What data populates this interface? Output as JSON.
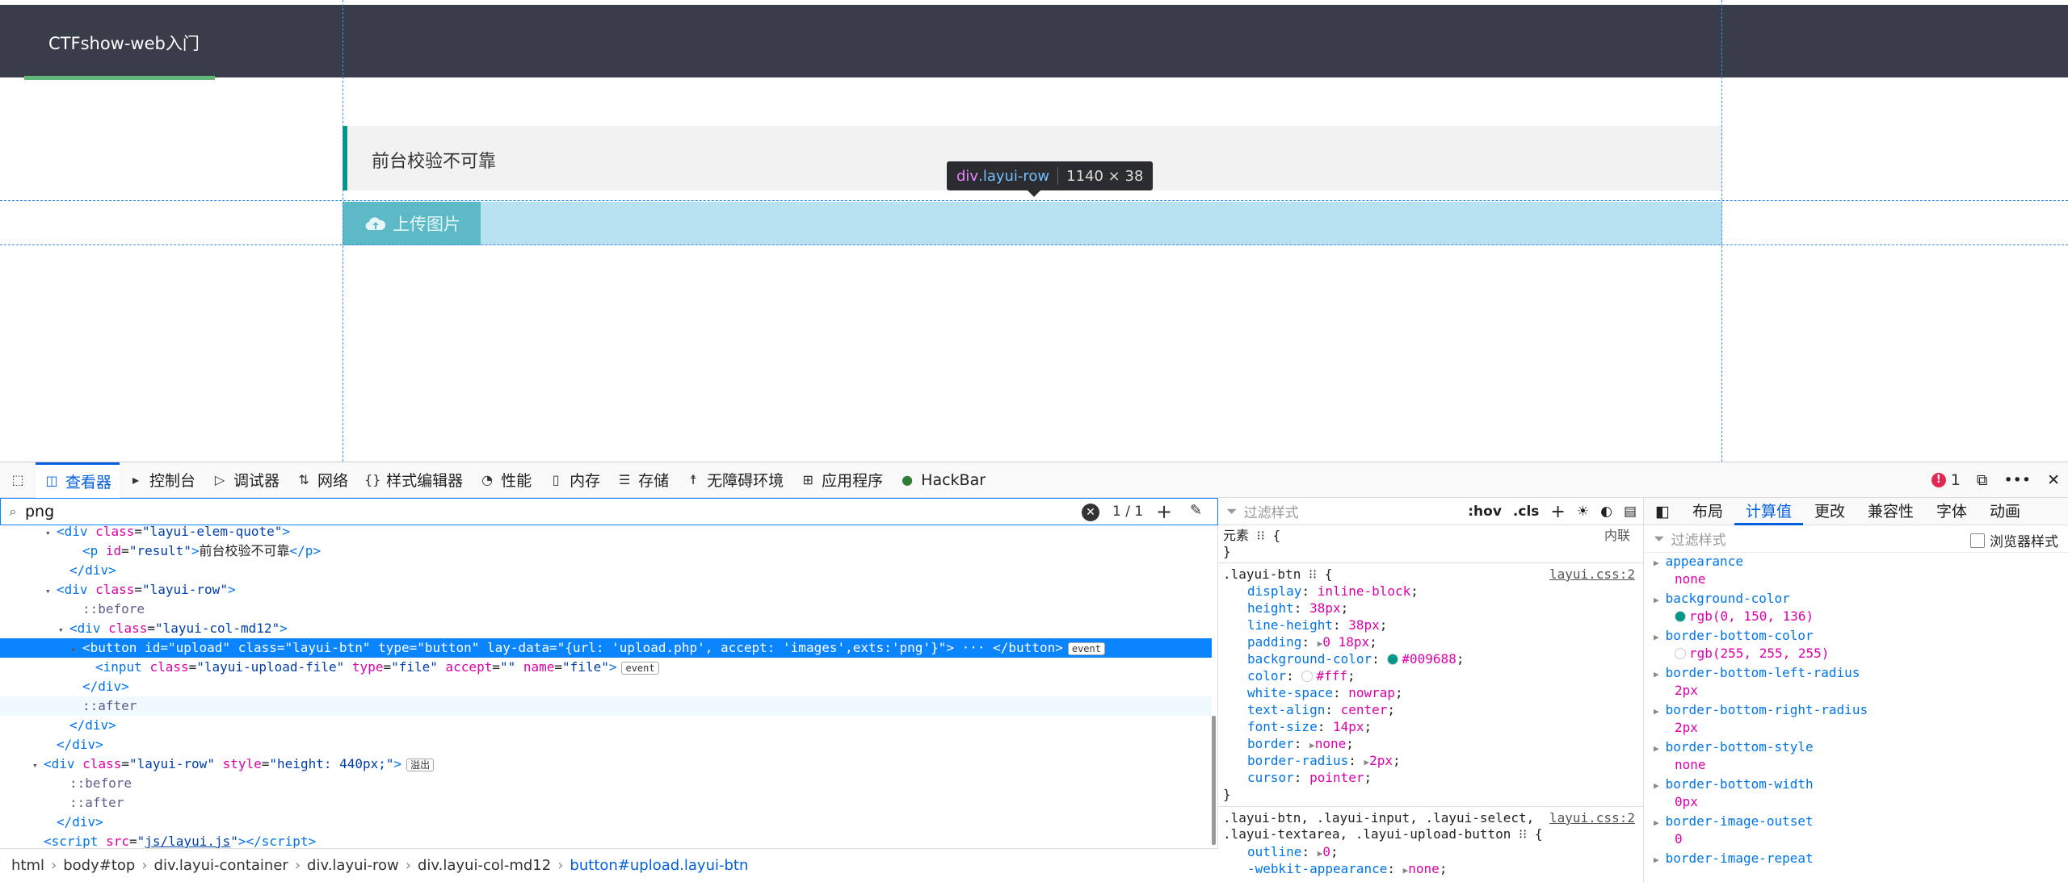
{
  "page": {
    "nav_title": "CTFshow-web入门",
    "quote_text": "前台校验不可靠",
    "upload_label": "上传图片",
    "tooltip": {
      "tag": "div",
      "cls": ".layui-row",
      "size": "1140 × 38"
    }
  },
  "devtools": {
    "tabs": [
      "查看器",
      "控制台",
      "调试器",
      "网络",
      "样式编辑器",
      "性能",
      "内存",
      "存储",
      "无障碍环境",
      "应用程序",
      "HackBar"
    ],
    "error_count": "1",
    "search_value": "png",
    "search_count": "1 / 1",
    "tree": [
      {
        "indent": 3,
        "twist": "▾",
        "html": "<span class='tg'>&lt;div</span> <span class='at'>class</span>=<span class='av'>\"layui-elem-quote\"</span><span class='tg'>&gt;</span>"
      },
      {
        "indent": 5,
        "twist": "",
        "html": "<span class='tg'>&lt;p</span> <span class='at'>id</span>=<span class='av'>\"result\"</span><span class='tg'>&gt;</span><span class='tx'>前台校验不可靠</span><span class='tg'>&lt;/p&gt;</span>"
      },
      {
        "indent": 4,
        "twist": "",
        "html": "<span class='tg'>&lt;/div&gt;</span>"
      },
      {
        "indent": 3,
        "twist": "▾",
        "html": "<span class='tg'>&lt;div</span> <span class='at'>class</span>=<span class='av'>\"layui-row\"</span><span class='tg'>&gt;</span>"
      },
      {
        "indent": 5,
        "twist": "",
        "html": "<span class='ps'>::before</span>"
      },
      {
        "indent": 4,
        "twist": "▾",
        "html": "<span class='tg'>&lt;div</span> <span class='at'>class</span>=<span class='av'>\"layui-col-md12\"</span><span class='tg'>&gt;</span>"
      },
      {
        "indent": 5,
        "twist": "▸",
        "sel": true,
        "html": "<span class='tg'>&lt;button</span> <span class='at'>id</span>=<span class='av'>\"upload\"</span> <span class='at'>class</span>=<span class='av'>\"layui-btn\"</span> <span class='at'>type</span>=<span class='av'>\"button\"</span> <span class='at'>lay-data</span>=<span class='av'>\"{url: 'upload.php', accept: 'images',exts:'png'}\"</span><span class='tg'>&gt;</span> ··· <span class='tg'>&lt;/button&gt;</span><span class='evt'>event</span>"
      },
      {
        "indent": 6,
        "twist": "",
        "html": "<span class='tg'>&lt;input</span> <span class='at'>class</span>=<span class='av'>\"layui-upload-file\"</span> <span class='at'>type</span>=<span class='av'>\"file\"</span> <span class='at'>accept</span>=<span class='av'>\"\"</span> <span class='at'>name</span>=<span class='av'>\"file\"</span><span class='tg'>&gt;</span><span class='evt'>event</span>"
      },
      {
        "indent": 5,
        "twist": "",
        "html": "<span class='tg'>&lt;/div&gt;</span>"
      },
      {
        "indent": 5,
        "twist": "",
        "hover": true,
        "html": "<span class='ps'>::after</span>"
      },
      {
        "indent": 4,
        "twist": "",
        "html": "<span class='tg'>&lt;/div&gt;</span>"
      },
      {
        "indent": 3,
        "twist": "",
        "html": "<span class='tg'>&lt;/div&gt;</span>"
      },
      {
        "indent": 2,
        "twist": "▾",
        "html": "<span class='tg'>&lt;div</span> <span class='at'>class</span>=<span class='av'>\"layui-row\"</span> <span class='at'>style</span>=<span class='av'>\"height: 440px;\"</span><span class='tg'>&gt;</span><span class='evt'>溢出</span>"
      },
      {
        "indent": 4,
        "twist": "",
        "html": "<span class='ps'>::before</span>"
      },
      {
        "indent": 4,
        "twist": "",
        "html": "<span class='ps'>::after</span>"
      },
      {
        "indent": 3,
        "twist": "",
        "html": "<span class='tg'>&lt;/div&gt;</span>"
      },
      {
        "indent": 2,
        "twist": "",
        "html": "<span class='tg'>&lt;script</span> <span class='at'>src</span>=<span class='av'>\"<u>js/layui.js</u>\"</span><span class='tg'>&gt;&lt;/script&gt;</span>"
      }
    ],
    "breadcrumb": [
      "html",
      "body#top",
      "div.layui-container",
      "div.layui-row",
      "div.layui-col-md12",
      "button#upload.layui-btn"
    ],
    "rules_filter_placeholder": "过滤样式",
    "rules_tools": [
      ":hov",
      ".cls"
    ],
    "rules": {
      "element_label": "元素",
      "element_src": "内联",
      "r1_selector": ".layui-btn",
      "r1_src": "layui.css:2",
      "r1_props": [
        {
          "n": "display",
          "v": "inline-block"
        },
        {
          "n": "height",
          "v": "38px"
        },
        {
          "n": "line-height",
          "v": "38px"
        },
        {
          "n": "padding",
          "v": "0 18px",
          "tw": true
        },
        {
          "n": "background-color",
          "v": "#009688",
          "sw": "#009688"
        },
        {
          "n": "color",
          "v": "#fff",
          "sw": "#ffffff"
        },
        {
          "n": "white-space",
          "v": "nowrap"
        },
        {
          "n": "text-align",
          "v": "center"
        },
        {
          "n": "font-size",
          "v": "14px"
        },
        {
          "n": "border",
          "v": "none",
          "tw": true
        },
        {
          "n": "border-radius",
          "v": "2px",
          "tw": true
        },
        {
          "n": "cursor",
          "v": "pointer"
        }
      ],
      "r2_selector_1": ".layui-btn, .layui-input, .layui-select,",
      "r2_selector_2": ".layui-textarea, .layui-upload-button",
      "r2_src": "layui.css:2",
      "r2_props": [
        {
          "n": "outline",
          "v": "0",
          "tw": true
        },
        {
          "n": "-webkit-appearance",
          "v": "none",
          "tw": true
        }
      ]
    },
    "comp_tabs": [
      "布局",
      "计算值",
      "更改",
      "兼容性",
      "字体",
      "动画"
    ],
    "comp_filter_placeholder": "过滤样式",
    "comp_browser_label": "浏览器样式",
    "computed": [
      {
        "n": "appearance",
        "v": "none"
      },
      {
        "n": "background-color",
        "v": "rgb(0, 150, 136)",
        "sw": "#009688"
      },
      {
        "n": "border-bottom-color",
        "v": "rgb(255, 255, 255)",
        "sw": "#ffffff"
      },
      {
        "n": "border-bottom-left-radius",
        "v": "2px"
      },
      {
        "n": "border-bottom-right-radius",
        "v": "2px"
      },
      {
        "n": "border-bottom-style",
        "v": "none"
      },
      {
        "n": "border-bottom-width",
        "v": "0px"
      },
      {
        "n": "border-image-outset",
        "v": "0"
      },
      {
        "n": "border-image-repeat",
        "v": ""
      }
    ]
  }
}
